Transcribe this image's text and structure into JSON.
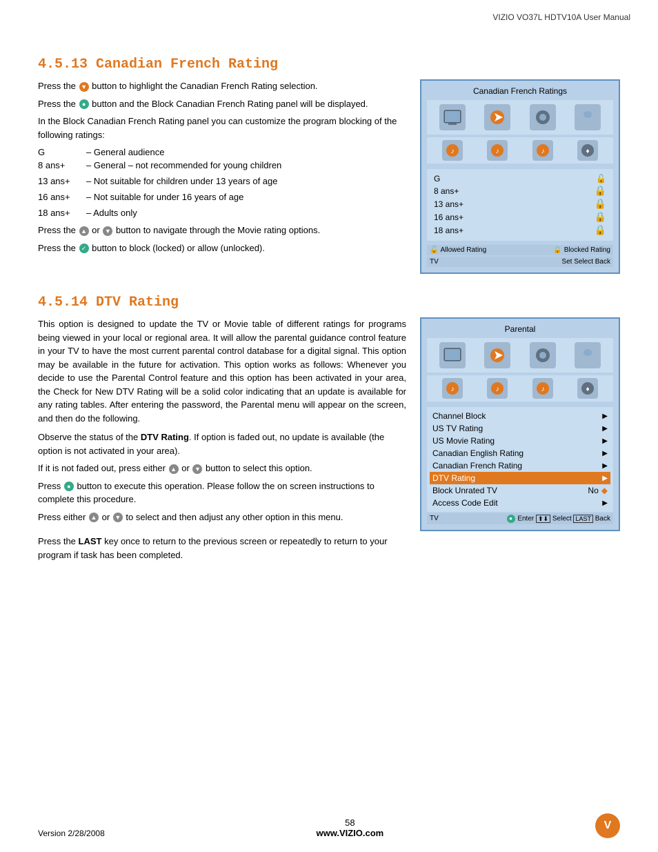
{
  "header": {
    "title": "VIZIO VO37L HDTV10A User Manual"
  },
  "section4513": {
    "title": "4.5.13 Canadian French Rating",
    "paragraphs": {
      "p1": "Press the  button to highlight the Canadian French Rating selection.",
      "p2": "Press the  button and the Block Canadian French Rating panel will be displayed.",
      "p3": "In the Block Canadian French Rating panel you can customize the program blocking of the following ratings:"
    },
    "ratings": [
      {
        "label": "G",
        "desc": "– General audience"
      },
      {
        "label": "8 ans+",
        "desc": "– General – not  recommended for young children"
      },
      {
        "label": "13 ans+",
        "desc": "– Not suitable for children under 13 years of age"
      },
      {
        "label": "16 ans+",
        "desc": "– Not suitable for under 16 years of age"
      },
      {
        "label": "18 ans+",
        "desc": "– Adults only"
      }
    ],
    "nav_text1": "Press the  or  button to navigate through the Movie rating options.",
    "nav_text2": "Press the  button to block (locked) or allow (unlocked).",
    "panel": {
      "title": "Canadian French Ratings",
      "rating_items": [
        "G",
        "8 ans+",
        "13 ans+",
        "16 ans+",
        "18 ans+"
      ],
      "legend_allowed": "Allowed Rating",
      "legend_blocked": "Blocked Rating",
      "footer_left": "TV",
      "footer_nav": "Set  Select  Back"
    }
  },
  "section4514": {
    "title": "4.5.14 DTV Rating",
    "intro": "This option is designed to update the TV or Movie table of different ratings for programs being viewed in your local or regional area. It will allow the parental guidance control feature in your TV to have the most current parental control database for a digital signal. This option may be available in the future for activation. This option works as follows: Whenever you decide to use the Parental Control feature and this option has been activated in your area, the Check for New DTV Rating will be a solid color indicating that an update is available for any rating tables. After entering the password, the Parental menu will appear on the screen, and then do the following.",
    "observe": "Observe the status of the ",
    "observe_bold": "DTV Rating",
    "observe2": ". If option is faded out, no update is available (the option is not activated in your area).",
    "if_not": "If it is not faded out, press either  or  button to select this option.",
    "press": " button to execute this operation. Please follow the on screen instructions to complete this procedure.",
    "press2": "Press either  or  to select and then adjust any other option in this menu.",
    "last_key": "Press the ",
    "last_bold": "LAST",
    "last_end": " key once to return to the previous screen or repeatedly to return to your program if task has been completed.",
    "panel": {
      "title": "Parental",
      "menu_items": [
        {
          "label": "Channel Block",
          "value": "",
          "type": "arrow",
          "highlighted": false
        },
        {
          "label": "US TV Rating",
          "value": "",
          "type": "arrow",
          "highlighted": false
        },
        {
          "label": "US Movie Rating",
          "value": "",
          "type": "arrow",
          "highlighted": false
        },
        {
          "label": "Canadian English Rating",
          "value": "",
          "type": "arrow",
          "highlighted": false
        },
        {
          "label": "Canadian French Rating",
          "value": "",
          "type": "arrow",
          "highlighted": false
        },
        {
          "label": "DTV Rating",
          "value": "",
          "type": "arrow",
          "highlighted": true
        },
        {
          "label": "Block Unrated TV",
          "value": "No",
          "type": "diamond",
          "highlighted": false
        },
        {
          "label": "Access Code Edit",
          "value": "",
          "type": "arrow",
          "highlighted": false
        }
      ],
      "footer_left": "TV",
      "footer_nav": "Enter  Select  Back"
    }
  },
  "footer": {
    "version": "Version 2/28/2008",
    "page_number": "58",
    "website": "www.VIZIO.com",
    "logo": "V"
  }
}
